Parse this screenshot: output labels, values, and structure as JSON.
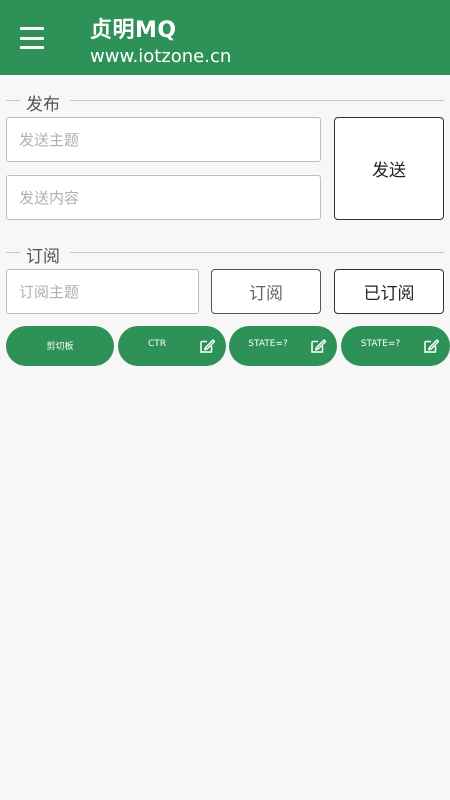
{
  "app": {
    "title": "贞明MQ",
    "subtitle": "www.iotzone.cn"
  },
  "icons": {
    "menu": "menu-icon",
    "edit": "edit-icon"
  },
  "colors": {
    "primary": "#2e9157",
    "background": "#f7f7f7"
  },
  "publish": {
    "legend": "发布",
    "topic_placeholder": "发送主题",
    "content_placeholder": "发送内容",
    "send_label": "发送"
  },
  "subscribe": {
    "legend": "订阅",
    "topic_placeholder": "订阅主题",
    "subscribe_label": "订阅",
    "subscribed_label": "已订阅"
  },
  "quick_buttons": [
    {
      "label": "剪切板"
    },
    {
      "label": "CTR"
    },
    {
      "label": "STATE=?"
    },
    {
      "label": "STATE=?"
    }
  ]
}
